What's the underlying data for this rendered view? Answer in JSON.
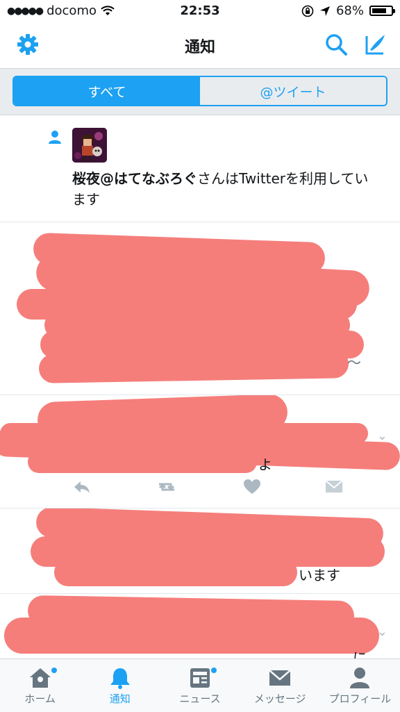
{
  "status_bar": {
    "carrier": "docomo",
    "time": "22:53",
    "battery": "68%"
  },
  "nav": {
    "title": "通知"
  },
  "segments": {
    "all": "すべて",
    "mentions": "@ツイート"
  },
  "notifications": [
    {
      "type": "follow",
      "user_name": "桜夜@はてなぶろぐ",
      "message_suffix": "さんはTwitterを利用しています"
    },
    {
      "type": "redacted",
      "visible_fragment": "〜"
    },
    {
      "type": "redacted",
      "visible_fragment": "よ"
    },
    {
      "type": "redacted",
      "visible_fragment": "います"
    },
    {
      "type": "redacted",
      "visible_fragment": "に"
    }
  ],
  "tab_bar": [
    {
      "label": "ホーム",
      "icon": "home-icon",
      "has_badge": true
    },
    {
      "label": "通知",
      "icon": "bell-icon",
      "active": true
    },
    {
      "label": "ニュース",
      "icon": "news-icon",
      "has_badge": true
    },
    {
      "label": "メッセージ",
      "icon": "envelope-icon"
    },
    {
      "label": "プロフィール",
      "icon": "person-icon"
    }
  ],
  "colors": {
    "accent": "#1da1f2",
    "redaction": "#f57e7b",
    "muted": "#66757f"
  }
}
